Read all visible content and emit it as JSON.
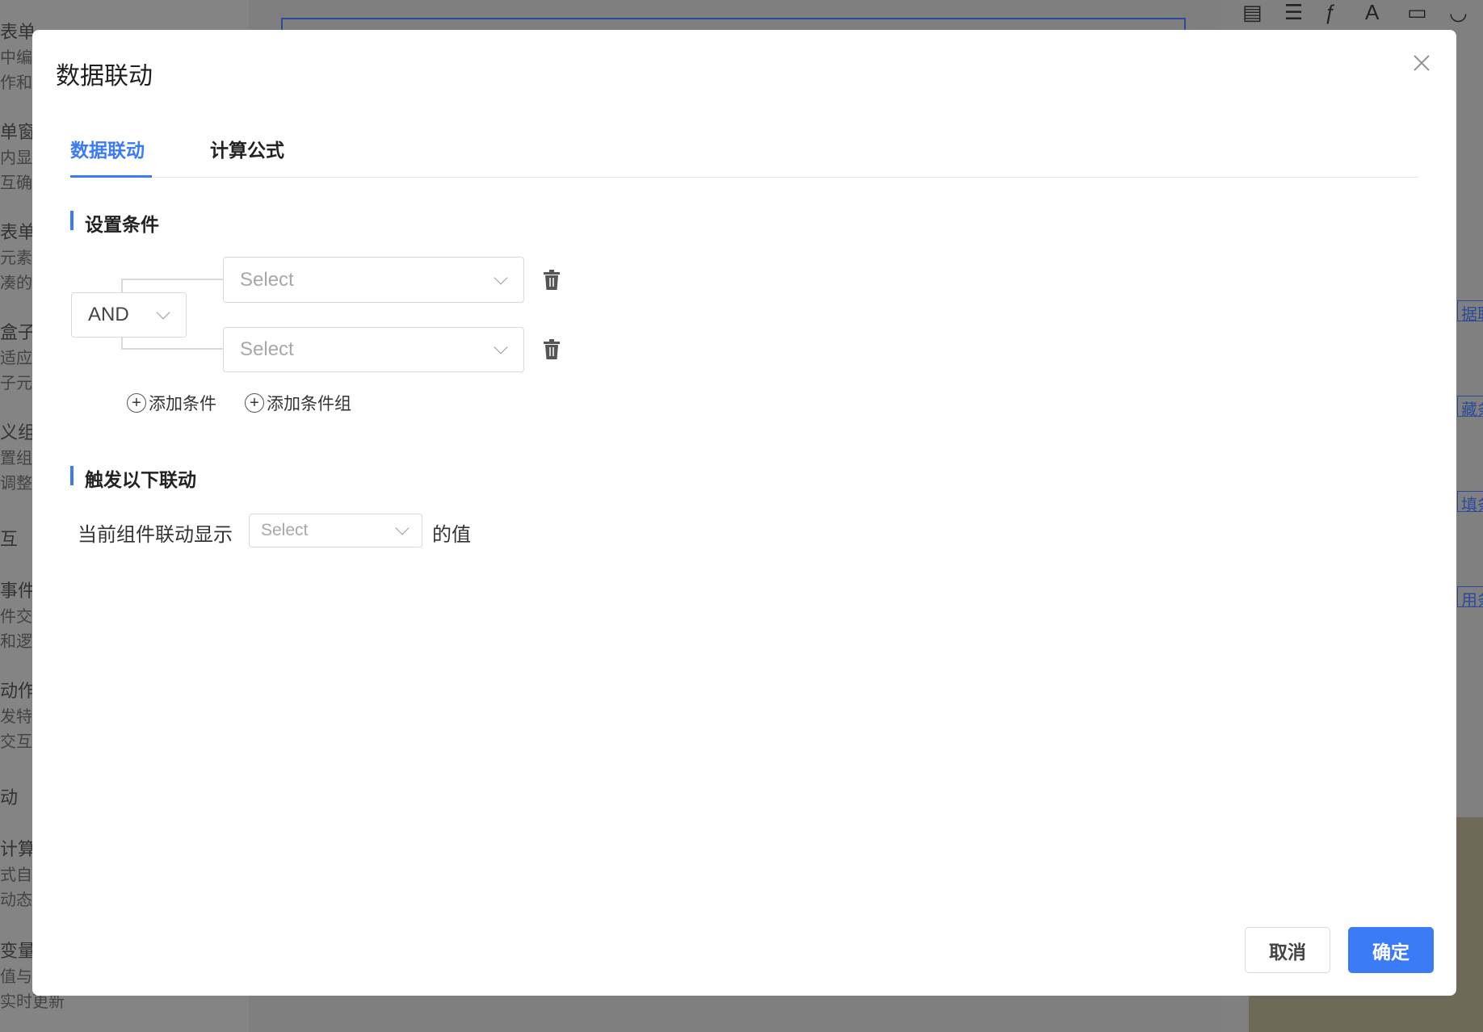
{
  "background": {
    "left_items": [
      "表单",
      "中编",
      "作和",
      "单窗",
      "内显",
      "互确",
      "表单",
      "元素",
      "凑的",
      "盒子",
      "适应",
      "子元",
      "义组",
      "置组",
      "调整",
      "互",
      "事件",
      "件交",
      "和逻",
      "动作",
      "发特",
      "交互",
      "动",
      "计算",
      "式自",
      "动态",
      "变量",
      "值与",
      "实时更新"
    ],
    "right_links": [
      "据联",
      "藏条",
      "填条",
      "用条"
    ]
  },
  "modal": {
    "title": "数据联动",
    "close_icon": "close-icon",
    "tabs": [
      {
        "label": "数据联动",
        "active": true
      },
      {
        "label": "计算公式",
        "active": false
      }
    ],
    "conditions": {
      "heading": "设置条件",
      "logic_operator": "AND",
      "rows": [
        {
          "placeholder": "Select"
        },
        {
          "placeholder": "Select"
        }
      ],
      "add_condition": "添加条件",
      "add_condition_group": "添加条件组"
    },
    "trigger": {
      "heading": "触发以下联动",
      "prefix": "当前组件联动显示",
      "select_placeholder": "Select",
      "suffix": "的值"
    },
    "footer": {
      "cancel": "取消",
      "confirm": "确定"
    },
    "accent_color": "#3b7bf6"
  }
}
